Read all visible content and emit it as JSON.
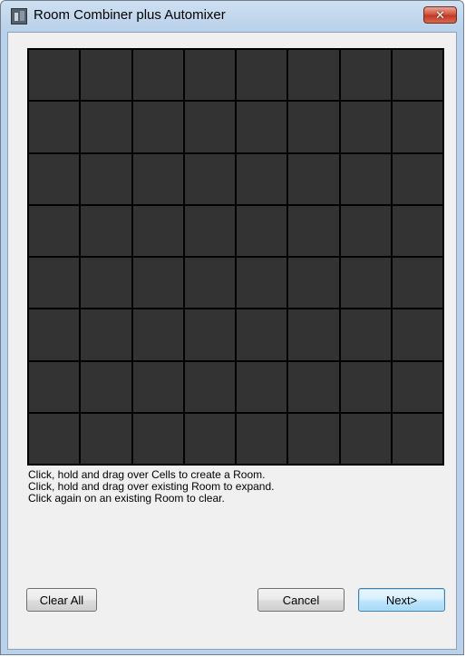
{
  "window": {
    "title": "Room Combiner plus Automixer",
    "close_symbol": "✕"
  },
  "grid": {
    "rows": 8,
    "columns": 8,
    "cell_color": "#333333",
    "line_color": "#000000"
  },
  "instructions": [
    "Click, hold and drag over Cells to create a Room.",
    "Click, hold and drag over existing Room to expand.",
    "Click again on an existing Room to clear."
  ],
  "buttons": {
    "clear_all": "Clear All",
    "cancel": "Cancel",
    "next": "Next>"
  },
  "colors": {
    "accent_button": "#3c7fb1",
    "close_button": "#c23a24",
    "window_frame": "#b9d1ea",
    "client_background": "#f0f0f0"
  }
}
